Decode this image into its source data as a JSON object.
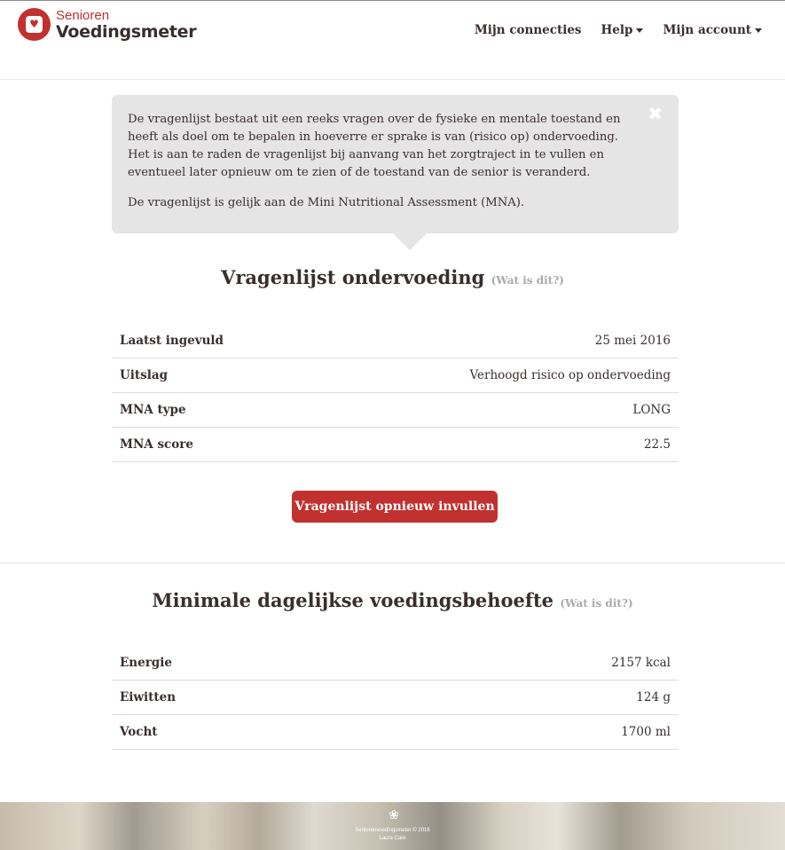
{
  "brand": {
    "small": "Senioren",
    "big": "Voedingsmeter",
    "color": "#c0312f"
  },
  "nav": {
    "connections": "Mijn connecties",
    "help": "Help",
    "account": "Mijn account"
  },
  "callout": {
    "paragraph1": "De vragenlijst bestaat uit een reeks vragen over de fysieke en mentale toestand en heeft als doel om te bepalen in hoeverre er sprake is van (risico op) ondervoeding. Het is aan te raden de vragenlijst bij aanvang van het zorgtraject in te vullen en eventueel later opnieuw om te zien of de toestand van de senior is veranderd.",
    "paragraph2": "De vragenlijst is gelijk aan de Mini Nutritional Assessment (MNA).",
    "close_icon": "close-icon"
  },
  "questionnaire": {
    "title": "Vragenlijst ondervoeding",
    "whatis": "(Wat is dit?)",
    "rows": [
      {
        "label": "Laatst ingevuld",
        "value": "25 mei 2016"
      },
      {
        "label": "Uitslag",
        "value": "Verhoogd risico op ondervoeding"
      },
      {
        "label": "MNA type",
        "value": "LONG"
      },
      {
        "label": "MNA score",
        "value": "22.5"
      }
    ],
    "button": "Vragenlijst opnieuw invullen"
  },
  "needs": {
    "title": "Minimale dagelijkse voedingsbehoefte",
    "whatis": "(Wat is dit?)",
    "rows": [
      {
        "label": "Energie",
        "value": "2157 kcal"
      },
      {
        "label": "Eiwitten",
        "value": "124 g"
      },
      {
        "label": "Vocht",
        "value": "1700 ml"
      }
    ]
  },
  "footer": {
    "line1": "Seniorenvoedingsmeter © 2016",
    "line2": "Laura Care",
    "icon": "flower-icon"
  }
}
